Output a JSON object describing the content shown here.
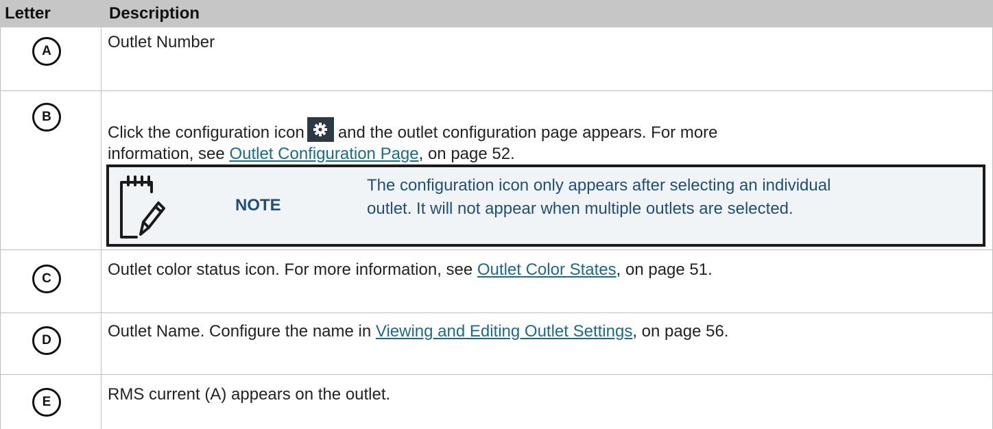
{
  "header": {
    "col1": "Letter",
    "col2": "Description"
  },
  "rows": [
    {
      "letter": "A",
      "text": "Outlet Number"
    },
    {
      "letter": "B",
      "line1_before": "Click the configuration icon",
      "line1_after": "and the outlet configuration page appears. For more",
      "line2_before": "information, see",
      "link": "Outlet Configuration Page",
      "line2_after": ", on page 52."
    },
    {
      "letter": "C",
      "before": "Outlet color status icon. For more information, see",
      "link": "Outlet Color States",
      "after": ", on page 51."
    },
    {
      "letter": "D",
      "before": "Outlet Name. Configure the name in",
      "link": "Viewing and Editing Outlet Settings",
      "after": ", on page 56."
    },
    {
      "letter": "E",
      "text": "RMS current (A) appears on the outlet."
    }
  ],
  "note": {
    "label": "NOTE",
    "line1": "The configuration icon only appears after selecting an individual",
    "line2": "outlet. It will not appear when multiple outlets are selected."
  },
  "icons": {
    "config": "gear-icon",
    "note": "notepad-pencil-icon"
  },
  "colors": {
    "header_bg": "#c6c6c6",
    "link": "#1a6a8a",
    "note_text": "#1f4e79",
    "note_bg": "#f1f4f7",
    "config_icon_bg": "#2e3946"
  }
}
